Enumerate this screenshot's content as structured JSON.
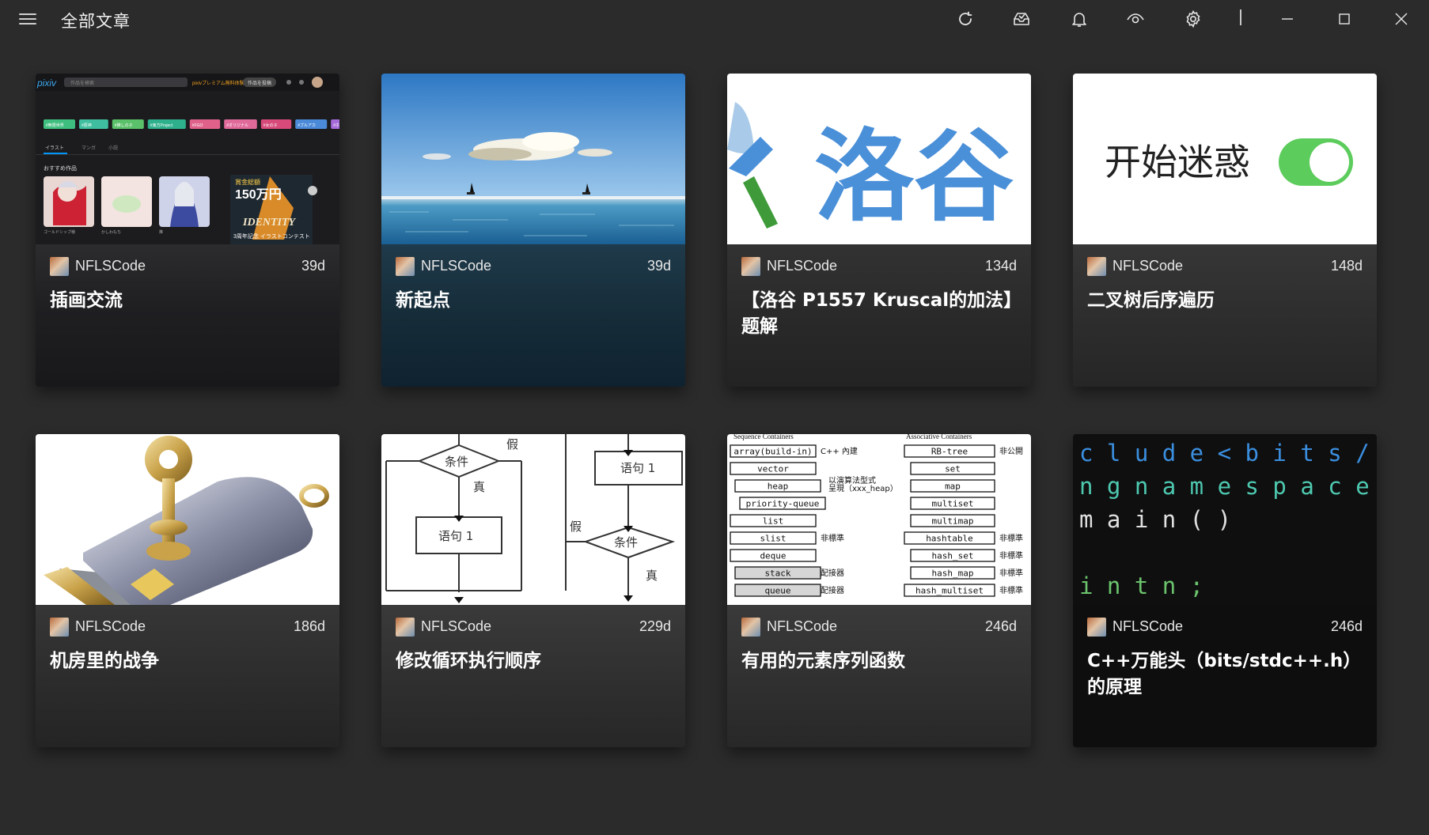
{
  "header": {
    "title": "全部文章",
    "icons": [
      "menu-icon",
      "refresh-icon",
      "inbox-icon",
      "bell-icon",
      "eye-icon",
      "gear-icon"
    ],
    "window_controls": [
      "minimize-icon",
      "maximize-icon",
      "close-icon"
    ]
  },
  "posts": [
    {
      "author": "NFLSCode",
      "age": "39d",
      "title": "插画交流",
      "thumb": "pixiv-screenshot"
    },
    {
      "author": "NFLSCode",
      "age": "39d",
      "title": "新起点",
      "thumb": "sea-sailboats"
    },
    {
      "author": "NFLSCode",
      "age": "134d",
      "title": "【洛谷 P1557 Kruscal的加法】题解",
      "thumb": "luogu-logo",
      "thumb_text": "洛谷"
    },
    {
      "author": "NFLSCode",
      "age": "148d",
      "title": "二叉树后序遍历",
      "thumb": "toggle-switch",
      "thumb_text": "开始迷惑"
    },
    {
      "author": "NFLSCode",
      "age": "186d",
      "title": "机房里的战争",
      "thumb": "usb-key"
    },
    {
      "author": "NFLSCode",
      "age": "229d",
      "title": "修改循环执行顺序",
      "thumb": "flowchart",
      "thumb_labels": {
        "cond": "条件",
        "true": "真",
        "false": "假",
        "stmt": "语句 1"
      }
    },
    {
      "author": "NFLSCode",
      "age": "246d",
      "title": "有用的元素序列函数",
      "thumb": "stl-containers",
      "thumb_labels": {
        "seq_header": "Sequence Containers",
        "assoc_header": "Associative Containers",
        "left": [
          "array(build-in)",
          "vector",
          "heap",
          "priority-queue",
          "list",
          "slist",
          "deque",
          "stack",
          "queue"
        ],
        "left_notes": [
          "C++ 內建",
          "",
          "以演算法型式",
          "呈現（xxx_heap）",
          "",
          "非標準",
          "",
          "配接器",
          "配接器"
        ],
        "right": [
          "RB-tree",
          "set",
          "map",
          "multiset",
          "multimap",
          "hashtable",
          "hash_set",
          "hash_map",
          "hash_multiset"
        ],
        "right_note": "非公開",
        "nonstd": "非標準"
      }
    },
    {
      "author": "NFLSCode",
      "age": "246d",
      "title": "C++万能头（bits/stdc++.h）的原理",
      "thumb": "code",
      "thumb_lines": [
        "c l u d e < b i t s / s t d",
        "n g   n a m e s p a c e   s",
        "  m a i n ( )",
        "",
        "  i n t     n ;"
      ]
    }
  ],
  "pixiv": {
    "logo": "pixiv",
    "search_placeholder": "作品を検索",
    "premium": "pixivプレミアム無料体験",
    "post_button": "作品を投稿",
    "tags": [
      "#無限世界",
      "#原神",
      "#推しの子",
      "#東方Project",
      "#FGO",
      "#オリジナル",
      "#女の子",
      "#ブルアカ",
      "#ホロライブ",
      "#ポケモン"
    ],
    "tabs": [
      "イラスト",
      "マンガ",
      "小説"
    ],
    "section": "おすすめ作品",
    "works": [
      "ゴールドシップ様",
      "かしわもち",
      "推"
    ],
    "ad_big": "150万円",
    "ad_small": "賞金総額",
    "ad_caption": "3周年記念 イラストコンテスト",
    "ad_word": "IDENTITY"
  },
  "colors": {
    "background": "#2b2b2b",
    "toggle": "#5ccc5c",
    "luogu_blue": "#4a90d9",
    "luogu_green": "#3f9b3a"
  }
}
